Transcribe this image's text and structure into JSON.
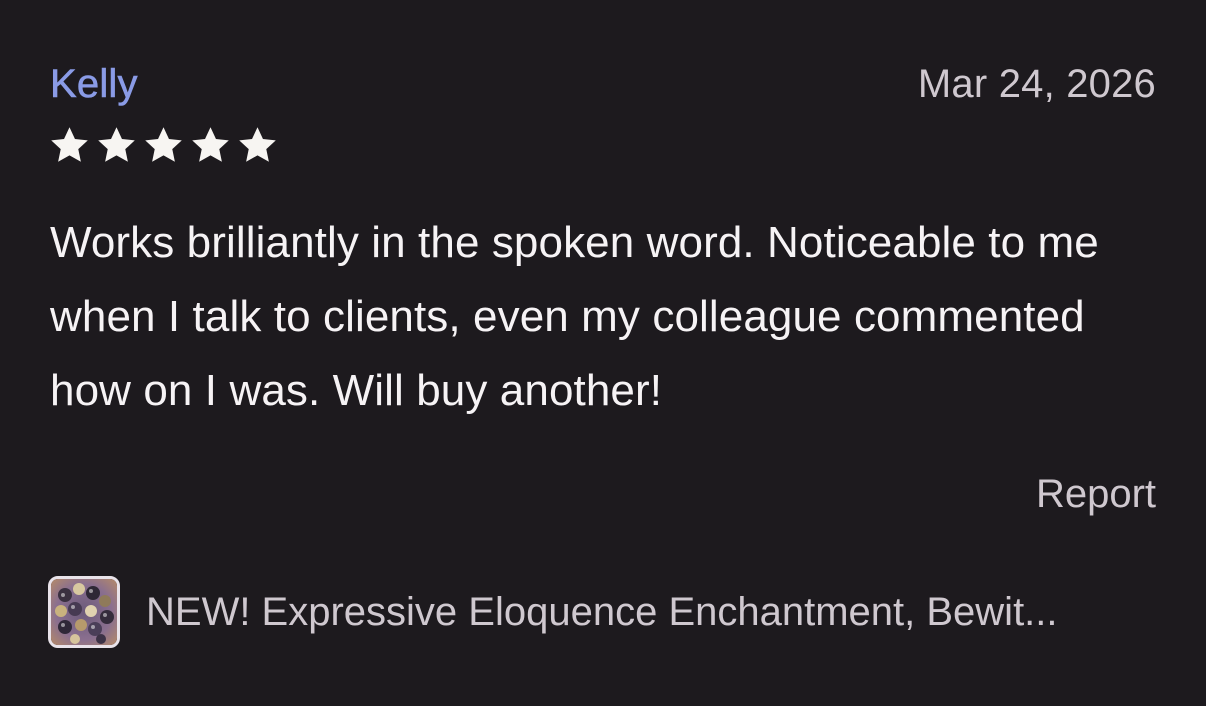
{
  "review": {
    "reviewer_name": "Kelly",
    "date": "Mar 24, 2026",
    "rating": 5,
    "rating_max": 5,
    "body": "Works brilliantly in the spoken word. Noticeable to me when I talk to clients, even my colleague commented how on I was. Will buy another!",
    "report_label": "Report"
  },
  "product": {
    "title": "NEW! Expressive Eloquence Enchantment, Bewit...",
    "thumbnail_icon": "product-thumbnail"
  },
  "colors": {
    "background": "#1d1a1e",
    "reviewer_name": "#8a9be6",
    "star": "#f7f5f2",
    "body_text": "#f6f3f5",
    "muted_text": "#cfc8cf"
  }
}
